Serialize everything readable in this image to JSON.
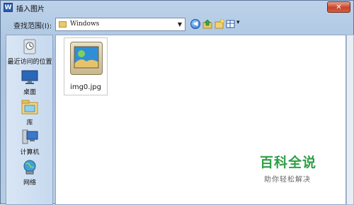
{
  "window": {
    "title": "插入图片",
    "app_icon_letter": "W",
    "close_symbol": "✕"
  },
  "toolbar": {
    "look_in_label": "查找范围(I):",
    "look_in_value": "Windows",
    "dropdown_symbol": "▼",
    "view_symbol": "▾"
  },
  "sidebar": {
    "items": [
      {
        "label": "最近访问的位置",
        "icon": "recent-places-icon"
      },
      {
        "label": "桌面",
        "icon": "desktop-icon"
      },
      {
        "label": "库",
        "icon": "libraries-icon"
      },
      {
        "label": "计算机",
        "icon": "computer-icon"
      },
      {
        "label": "网络",
        "icon": "network-icon"
      }
    ]
  },
  "files": [
    {
      "name": "img0.jpg",
      "icon": "image-file-icon"
    }
  ],
  "watermark": {
    "title": "百科全说",
    "subtitle": "助你轻松解决"
  }
}
